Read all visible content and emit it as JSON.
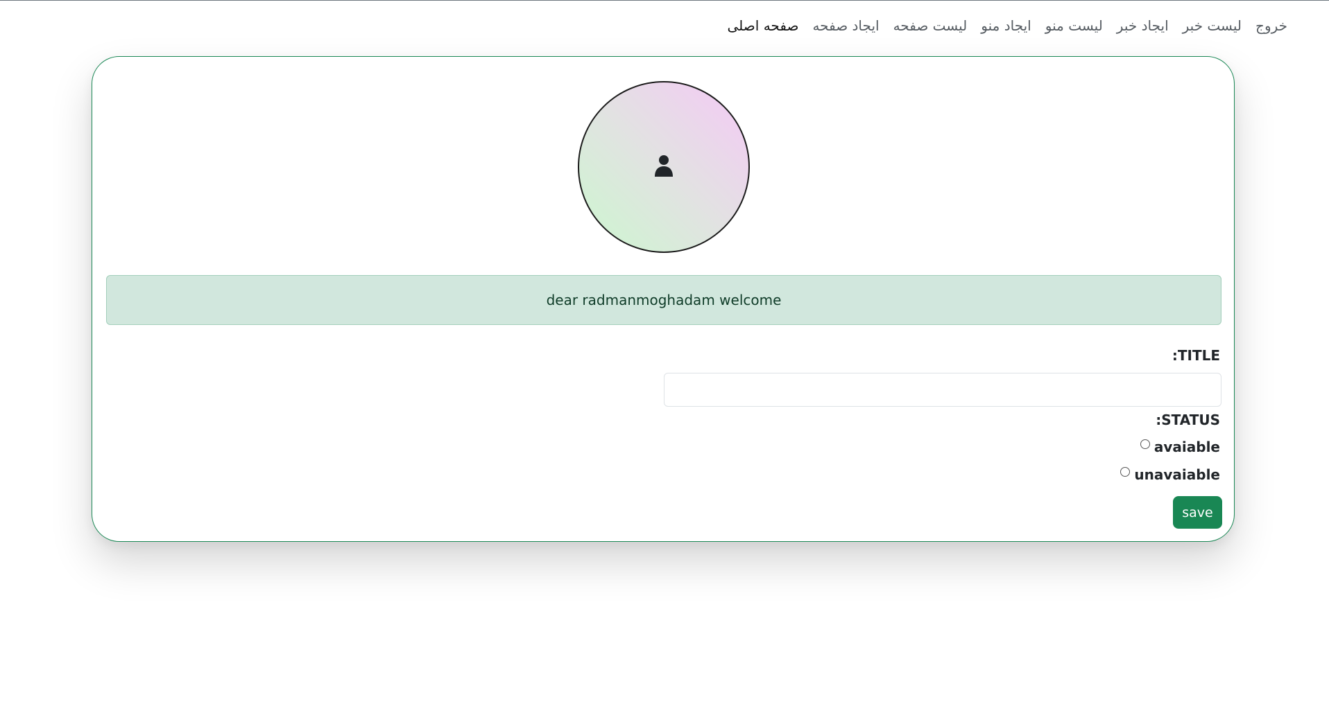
{
  "nav": {
    "items": [
      {
        "label": "صفحه اصلی"
      },
      {
        "label": "ایجاد صفحه"
      },
      {
        "label": "لیست صفحه"
      },
      {
        "label": "ایجاد منو"
      },
      {
        "label": "لیست منو"
      },
      {
        "label": "ایجاد خبر"
      },
      {
        "label": "لیست خبر"
      },
      {
        "label": "خروج"
      }
    ]
  },
  "avatar": {
    "icon": "user-icon"
  },
  "alert": {
    "text": "dear radmanmoghadam welcome"
  },
  "form": {
    "title_label": ":TITLE",
    "title_value": "",
    "status_label": ":STATUS",
    "options": [
      {
        "label": "avaiable",
        "checked": false
      },
      {
        "label": "unavaiable",
        "checked": false
      }
    ],
    "save_label": "save"
  },
  "colors": {
    "accent": "#198754",
    "alert_bg": "#d1e7dd",
    "alert_text": "#0f3c28"
  }
}
